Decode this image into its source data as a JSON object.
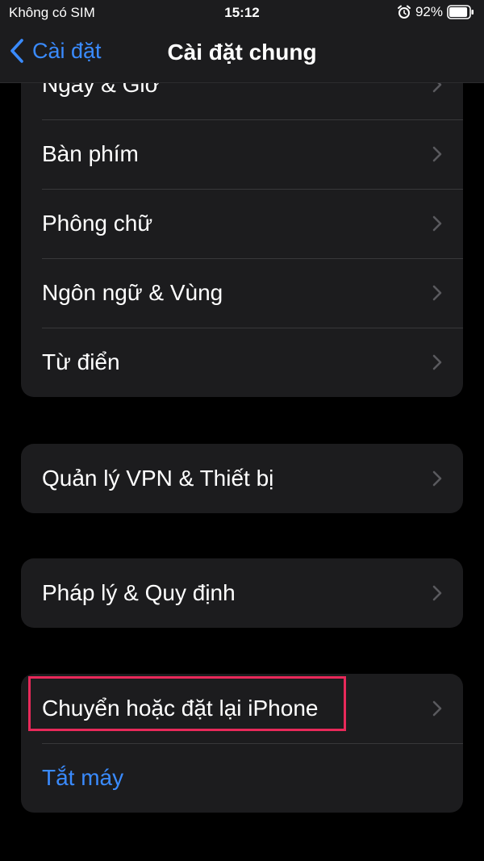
{
  "status_bar": {
    "carrier": "Không có SIM",
    "time": "15:12",
    "battery_percent": "92%",
    "battery_level": 0.92,
    "alarm_icon": "alarm-clock-icon"
  },
  "nav": {
    "back_label": "Cài đặt",
    "title": "Cài đặt chung",
    "back_icon": "chevron-left-icon"
  },
  "groups": {
    "g1": {
      "items": [
        {
          "label": "Ngày & Giờ"
        },
        {
          "label": "Bàn phím"
        },
        {
          "label": "Phông chữ"
        },
        {
          "label": "Ngôn ngữ & Vùng"
        },
        {
          "label": "Từ điển"
        }
      ]
    },
    "g2": {
      "items": [
        {
          "label": "Quản lý VPN & Thiết bị"
        }
      ]
    },
    "g3": {
      "items": [
        {
          "label": "Pháp lý & Quy định"
        }
      ]
    },
    "g4": {
      "items": [
        {
          "label": "Chuyển hoặc đặt lại iPhone"
        },
        {
          "label": "Tắt máy"
        }
      ]
    }
  },
  "colors": {
    "background": "#000000",
    "cell": "#1c1c1e",
    "accent": "#3a8bff",
    "highlight": "#e8295a",
    "chevron": "#5a5a5e"
  }
}
